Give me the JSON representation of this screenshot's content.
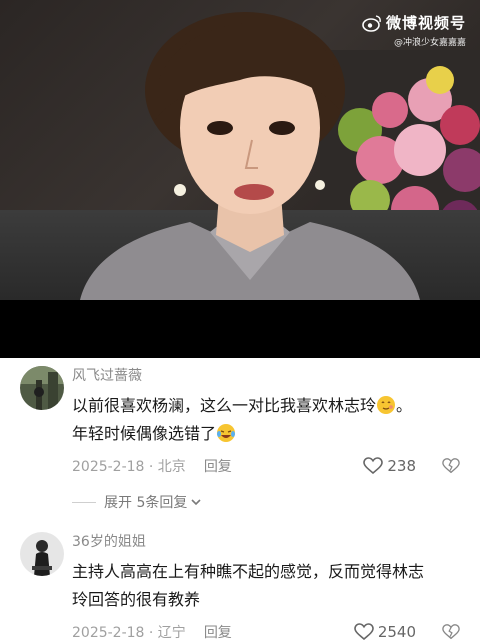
{
  "watermark": {
    "name": "微博视频号",
    "handle": "@冲浪少女嘉嘉嘉"
  },
  "comments": [
    {
      "username": "风飞过蔷薇",
      "text_line1": "以前很喜欢杨澜，这么一对比我喜欢林志玲",
      "text_line1_end": "。",
      "text_line2": "年轻时候偶像选错了",
      "date_location": "2025-2-18 · 北京",
      "reply_label": "回复",
      "likes": "238",
      "expand_label": "展开 5条回复",
      "emoji1": "shy-smile-emoji",
      "emoji2": "laugh-cry-emoji"
    },
    {
      "username": "36岁的姐姐",
      "text_line1": "主持人高高在上有种瞧不起的感觉，反而觉得林志",
      "text_line2": "玲回答的很有教养",
      "date_location": "2025-2-18 · 辽宁",
      "reply_label": "回复",
      "likes": "2540"
    }
  ],
  "colors": {
    "username": "#8a8a8a",
    "text": "#1a1a1a",
    "meta": "#a0a0a0"
  }
}
